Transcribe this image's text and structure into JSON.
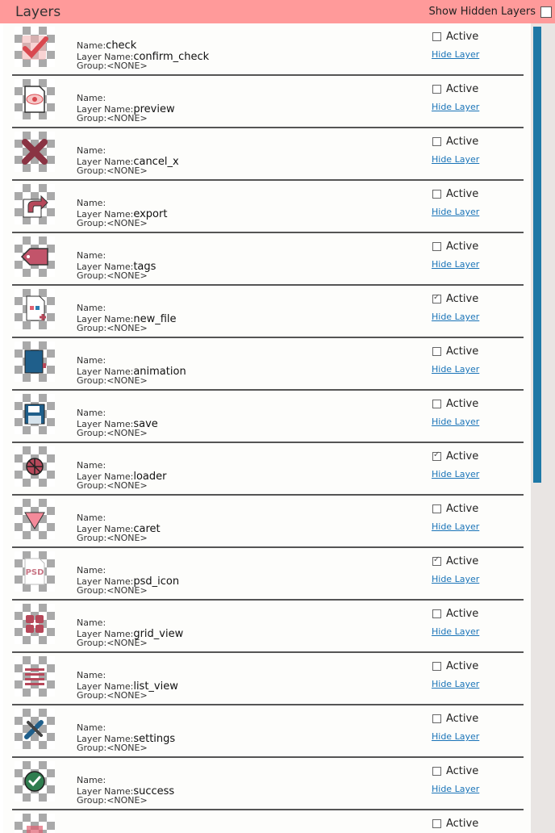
{
  "header": {
    "title": "Layers",
    "show_hidden_label": "Show Hidden Layers"
  },
  "labels": {
    "name": "Name:",
    "layer_name": "Layer Name:",
    "group": "Group:",
    "active": "Active",
    "hide_layer": "Hide Layer"
  },
  "layers": [
    {
      "name": "check",
      "layer_name": "confirm_check",
      "group": "<NONE>",
      "active": false,
      "icon": "check-icon"
    },
    {
      "name": "",
      "layer_name": "preview",
      "group": "<NONE>",
      "active": false,
      "icon": "preview-icon"
    },
    {
      "name": "",
      "layer_name": "cancel_x",
      "group": "<NONE>",
      "active": false,
      "icon": "cancel-x-icon"
    },
    {
      "name": "",
      "layer_name": "export",
      "group": "<NONE>",
      "active": false,
      "icon": "export-icon"
    },
    {
      "name": "",
      "layer_name": "tags",
      "group": "<NONE>",
      "active": false,
      "icon": "tag-icon"
    },
    {
      "name": "",
      "layer_name": "new_file",
      "group": "<NONE>",
      "active": true,
      "icon": "new-file-icon"
    },
    {
      "name": "",
      "layer_name": "animation",
      "group": "<NONE>",
      "active": false,
      "icon": "animation-icon"
    },
    {
      "name": "",
      "layer_name": "save",
      "group": "<NONE>",
      "active": false,
      "icon": "save-icon"
    },
    {
      "name": "",
      "layer_name": "loader",
      "group": "<NONE>",
      "active": true,
      "icon": "loader-icon"
    },
    {
      "name": "",
      "layer_name": "caret",
      "group": "<NONE>",
      "active": false,
      "icon": "caret-icon"
    },
    {
      "name": "",
      "layer_name": "psd_icon",
      "group": "<NONE>",
      "active": true,
      "icon": "psd-icon"
    },
    {
      "name": "",
      "layer_name": "grid_view",
      "group": "<NONE>",
      "active": false,
      "icon": "grid-view-icon"
    },
    {
      "name": "",
      "layer_name": "list_view",
      "group": "<NONE>",
      "active": false,
      "icon": "list-view-icon"
    },
    {
      "name": "",
      "layer_name": "settings",
      "group": "<NONE>",
      "active": false,
      "icon": "settings-icon"
    },
    {
      "name": "",
      "layer_name": "success",
      "group": "<NONE>",
      "active": false,
      "icon": "success-icon"
    },
    {
      "name": "",
      "layer_name": "",
      "group": "",
      "active": false,
      "icon": "unknown-icon"
    }
  ]
}
